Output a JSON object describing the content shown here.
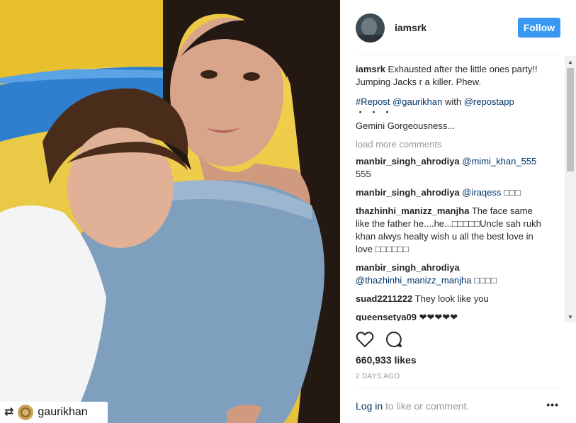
{
  "post": {
    "repost_tag": {
      "name": "gaurikhan"
    }
  },
  "header": {
    "username": "iamsrk",
    "follow_label": "Follow"
  },
  "caption": {
    "user": "iamsrk",
    "text": "Exhausted after the little ones party!! Jumping Jacks r a killer. Phew.",
    "repost_hashtag": "#Repost",
    "repost_user": "@gaurikhan",
    "repost_with": "with",
    "repost_app": "@repostapp",
    "dots": "・・・",
    "quote": "Gemini Gorgeousness..."
  },
  "load_more": "load more comments",
  "comments": [
    {
      "user": "manbir_singh_ahrodiya",
      "mention": "@mimi_khan_555",
      "text": "555"
    },
    {
      "user": "manbir_singh_ahrodiya",
      "mention": "@iraqess",
      "text": "□□□"
    },
    {
      "user": "thazhinhi_manizz_manjha",
      "mention": "",
      "text": "The face same like the father he....he...□□□□□Uncle sah rukh khan alwys healty wish u all the best love in love □□□□□□"
    },
    {
      "user": "manbir_singh_ahrodiya",
      "mention": "@thazhinhi_manizz_manjha",
      "text": "□□□□"
    },
    {
      "user": "suad2211222",
      "mention": "",
      "text": "They look like you"
    },
    {
      "user": "queensetya09",
      "mention": "",
      "text": "❤❤❤❤❤"
    }
  ],
  "stats": {
    "likes": "660,933 likes",
    "timestamp": "2 DAYS AGO"
  },
  "footer": {
    "login": "Log in",
    "rest": " to like or comment.",
    "more": "•••"
  },
  "icons": {
    "like": "heart-icon",
    "comment": "comment-bubble-icon",
    "repost": "repost-icon",
    "more": "more-options-icon"
  },
  "colors": {
    "follow_button": "#3897f0",
    "link": "#003569",
    "muted": "#999999"
  }
}
